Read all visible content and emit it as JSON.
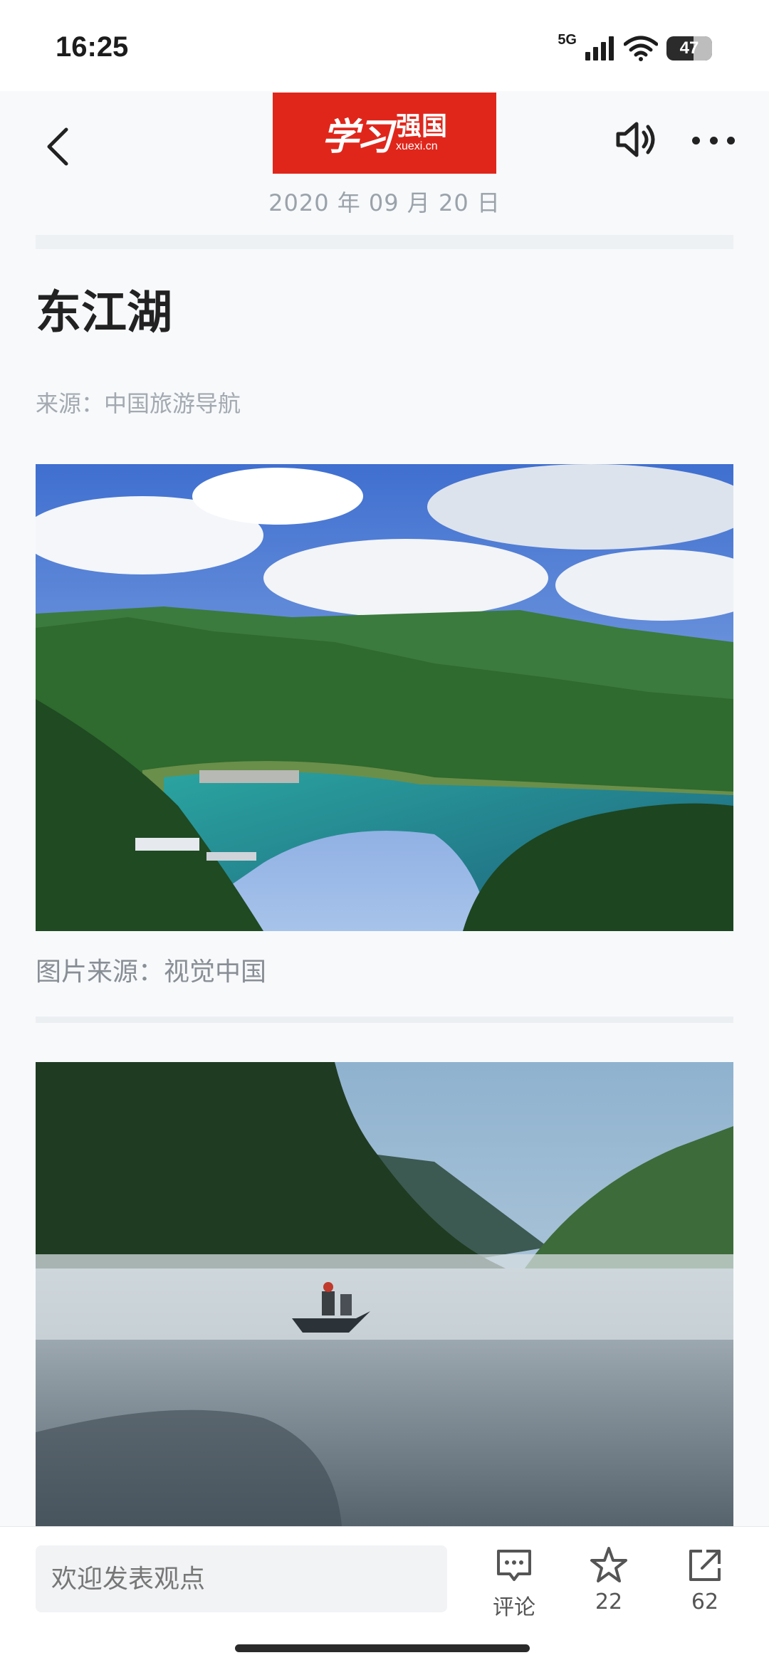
{
  "status_bar": {
    "time": "16:25",
    "network": "5G",
    "battery": "47"
  },
  "header": {
    "logo_script": "学习",
    "logo_name": "强国",
    "logo_url": "xuexi.cn",
    "date": "2020 年 09 月 20 日",
    "icons": [
      "back-arrow-icon",
      "speaker-icon",
      "more-dots-icon"
    ]
  },
  "article": {
    "title": "东江湖",
    "source": "来源：中国旅游导航",
    "photo1_caption": "图片来源：视觉中国"
  },
  "bottom_bar": {
    "comment_placeholder": "欢迎发表观点",
    "comment_label": "评论",
    "favorite_count": "22",
    "share_count": "62"
  },
  "colors": {
    "brand_red": "#e0261b",
    "page_bg": "#f7f9fb",
    "muted_text": "#a3a9b0"
  }
}
